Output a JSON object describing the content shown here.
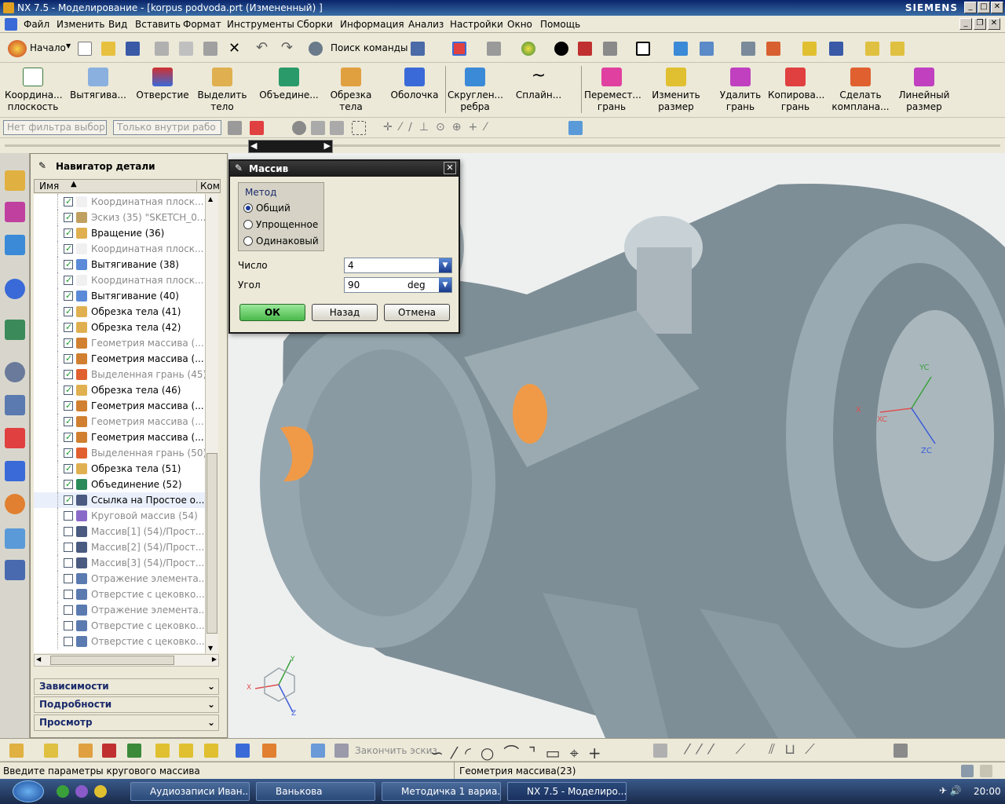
{
  "titlebar": {
    "title": "NX 7.5 - Моделирование - [korpus podvoda.prt (Измененный) ]",
    "brand": "SIEMENS"
  },
  "menu": [
    "Файл",
    "Изменить",
    "Вид",
    "Вставить",
    "Формат",
    "Инструменты",
    "Сборки",
    "Информация",
    "Анализ",
    "Настройки",
    "Окно",
    "Помощь"
  ],
  "toolbar1": {
    "start": "Начало",
    "search": "Поиск команды"
  },
  "toolbar2": [
    {
      "l1": "Координа...",
      "l2": "плоскость"
    },
    {
      "l1": "Вытягива...",
      "l2": ""
    },
    {
      "l1": "Отверстие",
      "l2": ""
    },
    {
      "l1": "Выделить",
      "l2": "тело"
    },
    {
      "l1": "Объедине...",
      "l2": ""
    },
    {
      "l1": "Обрезка",
      "l2": "тела"
    },
    {
      "l1": "Оболочка",
      "l2": ""
    },
    {
      "l1": "Скруглен...",
      "l2": "ребра"
    },
    {
      "l1": "Сплайн...",
      "l2": ""
    },
    {
      "l1": "Перемест...",
      "l2": "грань"
    },
    {
      "l1": "Изменить",
      "l2": "размер"
    },
    {
      "l1": "Удалить",
      "l2": "грань"
    },
    {
      "l1": "Копирова...",
      "l2": "грань"
    },
    {
      "l1": "Сделать",
      "l2": "комплана..."
    },
    {
      "l1": "Линейный",
      "l2": "размер"
    }
  ],
  "filters": {
    "filter1": "Нет фильтра выбор",
    "filter2": "Только внутри рабо"
  },
  "navigator": {
    "title": "Навигатор детали",
    "col_name": "Имя",
    "col_comment": "Ком",
    "items": [
      {
        "label": "Координатная плоск...",
        "checked": true,
        "dim": true,
        "color": "#f0f0f0"
      },
      {
        "label": "Эскиз (35) \"SKETCH_0...",
        "checked": true,
        "dim": true,
        "color": "#c0a060"
      },
      {
        "label": "Вращение (36)",
        "checked": true,
        "dim": false,
        "color": "#e0b050"
      },
      {
        "label": "Координатная плоск...",
        "checked": true,
        "dim": true,
        "color": "#f0f0f0"
      },
      {
        "label": "Вытягивание (38)",
        "checked": true,
        "dim": false,
        "color": "#5a8ad8"
      },
      {
        "label": "Координатная плоск...",
        "checked": true,
        "dim": true,
        "color": "#f0f0f0"
      },
      {
        "label": "Вытягивание (40)",
        "checked": true,
        "dim": false,
        "color": "#5a8ad8"
      },
      {
        "label": "Обрезка тела (41)",
        "checked": true,
        "dim": false,
        "color": "#e0b050"
      },
      {
        "label": "Обрезка тела (42)",
        "checked": true,
        "dim": false,
        "color": "#e0b050"
      },
      {
        "label": "Геометрия массива (...",
        "checked": true,
        "dim": true,
        "color": "#d08030"
      },
      {
        "label": "Геометрия массива (...",
        "checked": true,
        "dim": false,
        "color": "#d08030"
      },
      {
        "label": "Выделенная грань (45)",
        "checked": true,
        "dim": true,
        "color": "#e06030"
      },
      {
        "label": "Обрезка тела (46)",
        "checked": true,
        "dim": false,
        "color": "#e0b050"
      },
      {
        "label": "Геометрия массива (...",
        "checked": true,
        "dim": false,
        "color": "#d08030"
      },
      {
        "label": "Геометрия массива (...",
        "checked": true,
        "dim": true,
        "color": "#d08030"
      },
      {
        "label": "Геометрия массива (...",
        "checked": true,
        "dim": false,
        "color": "#d08030"
      },
      {
        "label": "Выделенная грань (50)",
        "checked": true,
        "dim": true,
        "color": "#e06030"
      },
      {
        "label": "Обрезка тела (51)",
        "checked": true,
        "dim": false,
        "color": "#e0b050"
      },
      {
        "label": "Объединение (52)",
        "checked": true,
        "dim": false,
        "color": "#2a8a5a"
      },
      {
        "label": "Ссылка на Простое о...",
        "checked": true,
        "dim": false,
        "color": "#4a5a80"
      },
      {
        "label": "Круговой массив (54)",
        "checked": false,
        "dim": true,
        "color": "#8a6ac8"
      },
      {
        "label": "Массив[1] (54)/Прост...",
        "checked": false,
        "dim": true,
        "color": "#4a5a80"
      },
      {
        "label": "Массив[2] (54)/Прост...",
        "checked": false,
        "dim": true,
        "color": "#4a5a80"
      },
      {
        "label": "Массив[3] (54)/Прост...",
        "checked": false,
        "dim": true,
        "color": "#4a5a80"
      },
      {
        "label": "Отражение элемента...",
        "checked": false,
        "dim": true,
        "color": "#5a7ab0"
      },
      {
        "label": "Отверстие с цековко...",
        "checked": false,
        "dim": true,
        "color": "#5a7ab0"
      },
      {
        "label": "Отражение элемента...",
        "checked": false,
        "dim": true,
        "color": "#5a7ab0"
      },
      {
        "label": "Отверстие с цековко...",
        "checked": false,
        "dim": true,
        "color": "#5a7ab0"
      },
      {
        "label": "Отверстие с цековко...",
        "checked": false,
        "dim": true,
        "color": "#5a7ab0"
      }
    ],
    "sections": [
      "Зависимости",
      "Подробности",
      "Просмотр"
    ]
  },
  "dialog": {
    "title": "Массив",
    "method_label": "Метод",
    "methods": [
      "Общий",
      "Упрощенное",
      "Одинаковый"
    ],
    "selected_method": "Общий",
    "count_label": "Число",
    "count_value": "4",
    "angle_label": "Угол",
    "angle_value": "90",
    "angle_unit": "deg",
    "ok": "ОК",
    "back": "Назад",
    "cancel": "Отмена"
  },
  "sketch_toolbar": {
    "finish": "Закончить эскиз"
  },
  "status": {
    "prompt": "Введите параметры кругового массива",
    "info": "Геометрия массива(23)"
  },
  "taskbar": {
    "tasks": [
      "Аудиозаписи Иван...",
      "Ванькова",
      "Методичка 1 вариа...",
      "NX 7.5 - Моделиро..."
    ],
    "time": "20:00"
  },
  "axes": {
    "x": "X",
    "y": "Y",
    "z": "Z",
    "xc": "XC",
    "yc": "YC",
    "zc": "ZC"
  },
  "colors": {
    "title_bg": "#0a246a",
    "part": "#8a9aa2",
    "highlight": "#f0a050",
    "ok_btn": "#5ac85a"
  }
}
